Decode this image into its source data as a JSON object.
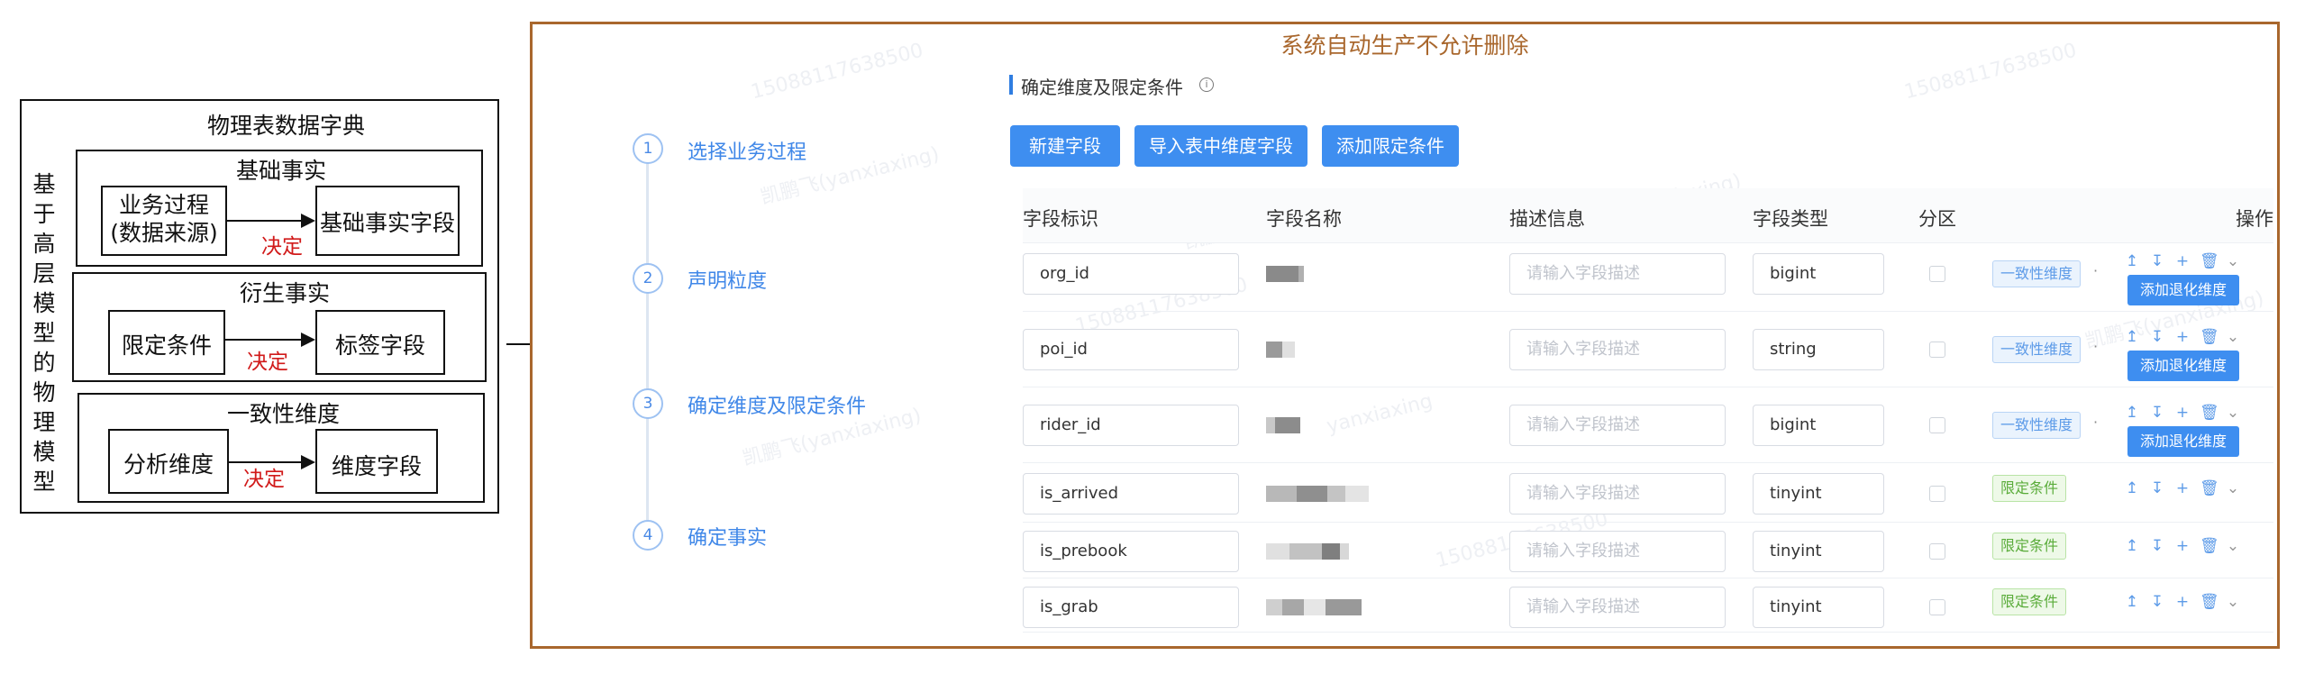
{
  "diagram": {
    "outer_title": "物理表数据字典",
    "vertical_label": "基于高层模型的物理模型",
    "groups": [
      {
        "title": "基础事实",
        "left": "业务过程\n(数据来源)",
        "right": "基础事实字段",
        "relation": "决定"
      },
      {
        "title": "衍生事实",
        "left": "限定条件",
        "right": "标签字段",
        "relation": "决定"
      },
      {
        "title": "一致性维度",
        "left": "分析维度",
        "right": "维度字段",
        "relation": "决定"
      }
    ]
  },
  "panel": {
    "banner": "系统自动生产不允许删除",
    "border_color": "#a9672d",
    "watermarks": [
      "凯鹏飞(yanxiaxing)",
      "15088117638500",
      "yanxiaxing"
    ],
    "steps": [
      {
        "num": "1",
        "label": "选择业务过程"
      },
      {
        "num": "2",
        "label": "声明粒度"
      },
      {
        "num": "3",
        "label": "确定维度及限定条件"
      },
      {
        "num": "4",
        "label": "确定事实"
      }
    ],
    "section_title": "确定维度及限定条件",
    "buttons": [
      "新建字段",
      "导入表中维度字段",
      "添加限定条件"
    ],
    "columns": [
      "字段标识",
      "字段名称",
      "描述信息",
      "字段类型",
      "分区",
      "操作"
    ],
    "desc_placeholder": "请输入字段描述",
    "tag_dimension": "一致性维度",
    "tag_condition": "限定条件",
    "degrade_button": "添加退化维度",
    "rows": [
      {
        "id": "org_id",
        "type": "bigint",
        "tag": "dimension",
        "degrade": true
      },
      {
        "id": "poi_id",
        "type": "string",
        "tag": "dimension",
        "degrade": true
      },
      {
        "id": "rider_id",
        "type": "bigint",
        "tag": "dimension",
        "degrade": true
      },
      {
        "id": "is_arrived",
        "type": "tinyint",
        "tag": "condition",
        "degrade": false
      },
      {
        "id": "is_prebook",
        "type": "tinyint",
        "tag": "condition",
        "degrade": false
      },
      {
        "id": "is_grab",
        "type": "tinyint",
        "tag": "condition",
        "degrade": false
      }
    ],
    "op_icons": [
      "move-up-icon",
      "move-down-icon",
      "add-icon",
      "delete-icon",
      "collapse-icon"
    ]
  }
}
